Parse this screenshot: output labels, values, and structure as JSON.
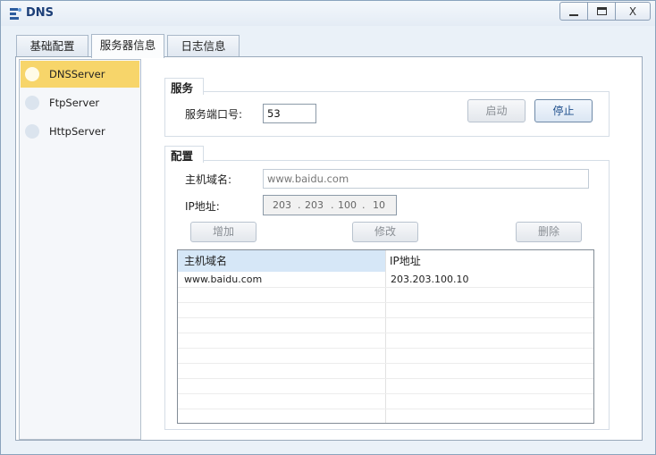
{
  "window": {
    "title": "DNS"
  },
  "tabs": [
    {
      "label": "基础配置"
    },
    {
      "label": "服务器信息"
    },
    {
      "label": "日志信息"
    }
  ],
  "servers": [
    {
      "label": "DNSServer",
      "selected": true
    },
    {
      "label": "FtpServer",
      "selected": false
    },
    {
      "label": "HttpServer",
      "selected": false
    }
  ],
  "service": {
    "group_label": "服务",
    "port_label": "服务端口号:",
    "port_value": "53",
    "start_label": "启动",
    "stop_label": "停止"
  },
  "config": {
    "group_label": "配置",
    "domain_label": "主机域名:",
    "domain_placeholder": "www.baidu.com",
    "ip_label": "IP地址:",
    "ip_octets": [
      "203",
      "203",
      "100",
      "10"
    ],
    "add_label": "增加",
    "modify_label": "修改",
    "delete_label": "删除"
  },
  "table": {
    "headers": [
      "主机域名",
      "IP地址"
    ],
    "rows": [
      [
        "www.baidu.com",
        "203.203.100.10"
      ]
    ]
  },
  "colors": {
    "selected_item": "#f7d56a",
    "active_button_text": "#1e4f8c",
    "header_highlight": "#d6e7f7"
  }
}
